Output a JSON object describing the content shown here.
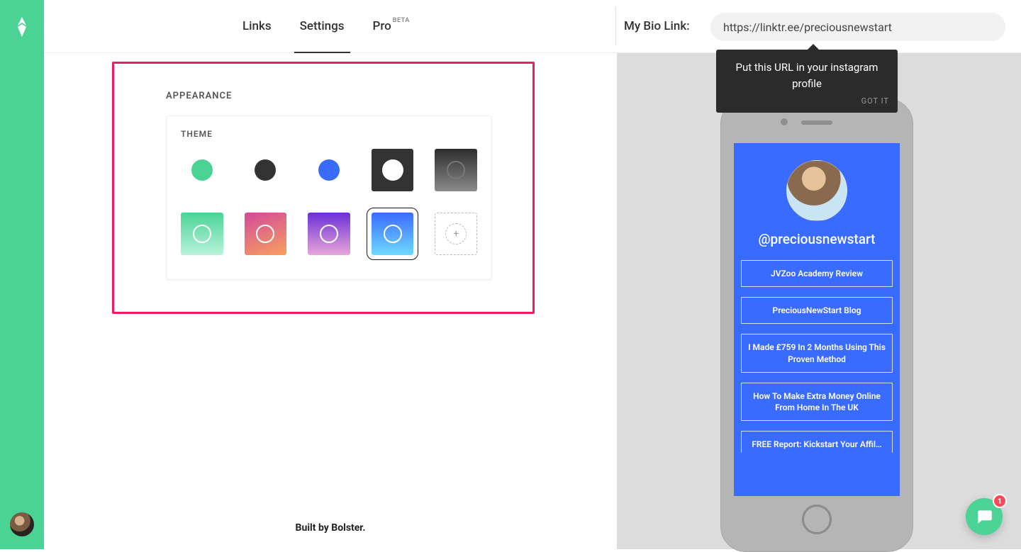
{
  "header": {
    "tabs": {
      "links": "Links",
      "settings": "Settings",
      "pro": "Pro",
      "pro_badge": "BETA"
    },
    "bio_label": "My Bio Link:",
    "bio_url": "https://linktr.ee/preciousnewstart",
    "tooltip_text": "Put this URL in your instagram profile",
    "tooltip_action": "GOT IT"
  },
  "appearance": {
    "section_title": "APPEARANCE",
    "theme_label": "THEME"
  },
  "preview": {
    "handle": "@preciousnewstart",
    "links": [
      "JVZoo Academy Review",
      "PreciousNewStart Blog",
      "I Made £759 In 2 Months Using This Proven Method",
      "How To Make Extra Money Online From Home In The UK",
      "FREE Report: Kickstart Your Affil…"
    ]
  },
  "footer": "Built by Bolster.",
  "chat_badge": "1"
}
